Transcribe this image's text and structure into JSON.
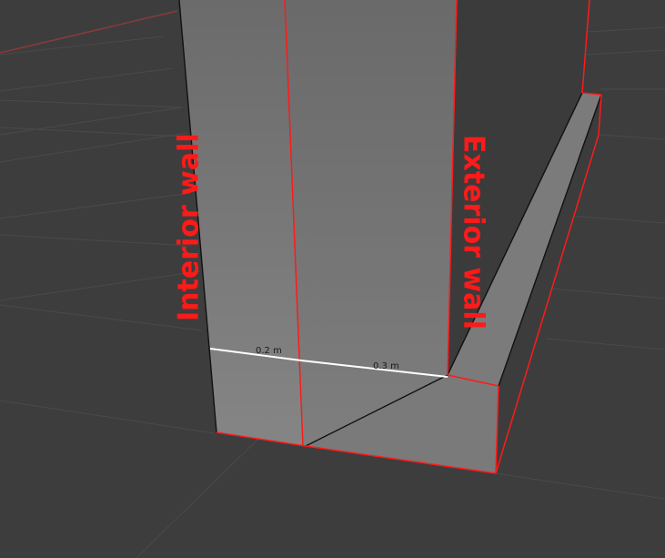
{
  "viewport": {
    "labels": {
      "interior": "Interior wall",
      "exterior": "Exterior wall"
    },
    "measurements": {
      "interior_thickness": "0.2 m",
      "exterior_thickness": "0.3 m"
    }
  },
  "colors": {
    "background": "#3d3d3d",
    "grid_line": "#4a4a4a",
    "x_axis": "#8a3a3a",
    "wall_face_light": "#787878",
    "wall_face_dark": "#3a3a3a",
    "edge_selected": "#ff1a1a",
    "measure_line": "#ffffff",
    "label_color": "#ff1a1a"
  }
}
